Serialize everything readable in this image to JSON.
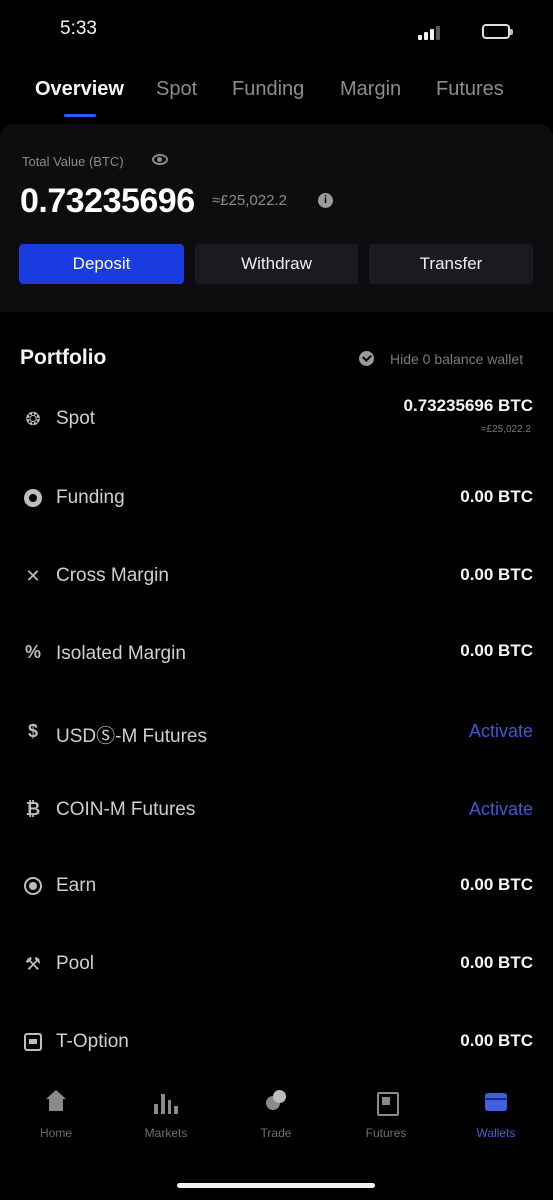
{
  "status_bar": {
    "time": "5:33"
  },
  "tabs": [
    {
      "label": "Overview"
    },
    {
      "label": "Spot"
    },
    {
      "label": "Funding"
    },
    {
      "label": "Margin"
    },
    {
      "label": "Futures"
    }
  ],
  "summary": {
    "label": "Total Value (BTC)",
    "value": "0.73235696",
    "approx": "≈£25,022.2",
    "info_glyph": "i"
  },
  "actions": {
    "deposit": "Deposit",
    "withdraw": "Withdraw",
    "transfer": "Transfer"
  },
  "portfolio": {
    "title": "Portfolio",
    "hide_zero": "Hide 0 balance wallet",
    "items": [
      {
        "name": "Spot",
        "value": "0.73235696 BTC",
        "sub": "≈£25,022.2",
        "icon": "spot-icon",
        "glyph": ""
      },
      {
        "name": "Funding",
        "value": "0.00 BTC",
        "icon": "funding-icon",
        "glyph": ""
      },
      {
        "name": "Cross Margin",
        "value": "0.00 BTC",
        "icon": "cross-margin-icon",
        "glyph": "✕"
      },
      {
        "name": "Isolated Margin",
        "value": "0.00 BTC",
        "icon": "isolated-margin-icon",
        "glyph": "%"
      },
      {
        "name": "USDⓈ-M Futures",
        "action": "Activate",
        "icon": "usds-futures-icon",
        "glyph": "$"
      },
      {
        "name": "COIN-M Futures",
        "action": "Activate",
        "icon": "coin-futures-icon",
        "glyph": "₿"
      },
      {
        "name": "Earn",
        "value": "0.00 BTC",
        "icon": "earn-icon",
        "glyph": ""
      },
      {
        "name": "Pool",
        "value": "0.00 BTC",
        "icon": "pool-icon",
        "glyph": "⚒"
      },
      {
        "name": "T-Option",
        "value": "0.00 BTC",
        "icon": "t-option-icon",
        "glyph": ""
      }
    ]
  },
  "bottom_nav": [
    {
      "label": "Home"
    },
    {
      "label": "Markets"
    },
    {
      "label": "Trade"
    },
    {
      "label": "Futures"
    },
    {
      "label": "Wallets"
    }
  ],
  "colors": {
    "accent": "#1a3be0",
    "activate": "#4058d8",
    "background": "#000000",
    "card": "#0d0d0f"
  }
}
